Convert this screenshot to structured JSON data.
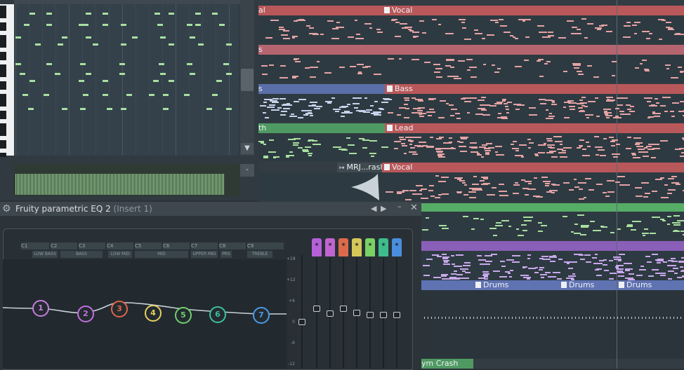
{
  "eq": {
    "title": "Fruity parametric EQ 2",
    "insert": "(Insert 1)",
    "band_columns": [
      "C1",
      "C2",
      "C3",
      "C4",
      "C5",
      "C6",
      "C7",
      "C8",
      "C9"
    ],
    "ranges": [
      "LOW BASS",
      "BASS",
      "LOW MID",
      "MID",
      "UPPER MID",
      "PRS",
      "TREBLE"
    ],
    "db_labels": [
      "+18",
      "+12",
      "+6",
      "0",
      "-6",
      "-12"
    ],
    "bands": [
      {
        "label": "1",
        "color": "#c77de0"
      },
      {
        "label": "2",
        "color": "#c070e0"
      },
      {
        "label": "3",
        "color": "#e06448"
      },
      {
        "label": "4",
        "color": "#e6d060"
      },
      {
        "label": "5",
        "color": "#6fd06a"
      },
      {
        "label": "6",
        "color": "#3fc0a0"
      },
      {
        "label": "7",
        "color": "#4a9ae6"
      }
    ],
    "fader_tab_colors": [
      "#b560d8",
      "#c264d0",
      "#dc6a4a",
      "#d6c858",
      "#7ad264",
      "#3ebc8c",
      "#4a8ee0"
    ]
  },
  "playlist": {
    "clips": {
      "vocal_left": "al",
      "vocal": "Vocal",
      "bass_left": "s",
      "bass": "Bass",
      "lead_left": "th",
      "lead": "Lead",
      "crash": "MRJ...rash",
      "vocal2": "Vocal",
      "drums1": "Drums",
      "drums2": "Drums",
      "drums3": "Drums",
      "cymcrash": "ym Crash"
    },
    "colors": {
      "vocal": "#b9585a",
      "pink": "#b56570",
      "bass_blue": "#5a6fa8",
      "lead_green": "#4f9a62",
      "green": "#56ad66",
      "purple": "#8a5fb8",
      "blue": "#5f72b2"
    }
  },
  "piano_roll": {
    "note_color": "#a8e0a0"
  }
}
